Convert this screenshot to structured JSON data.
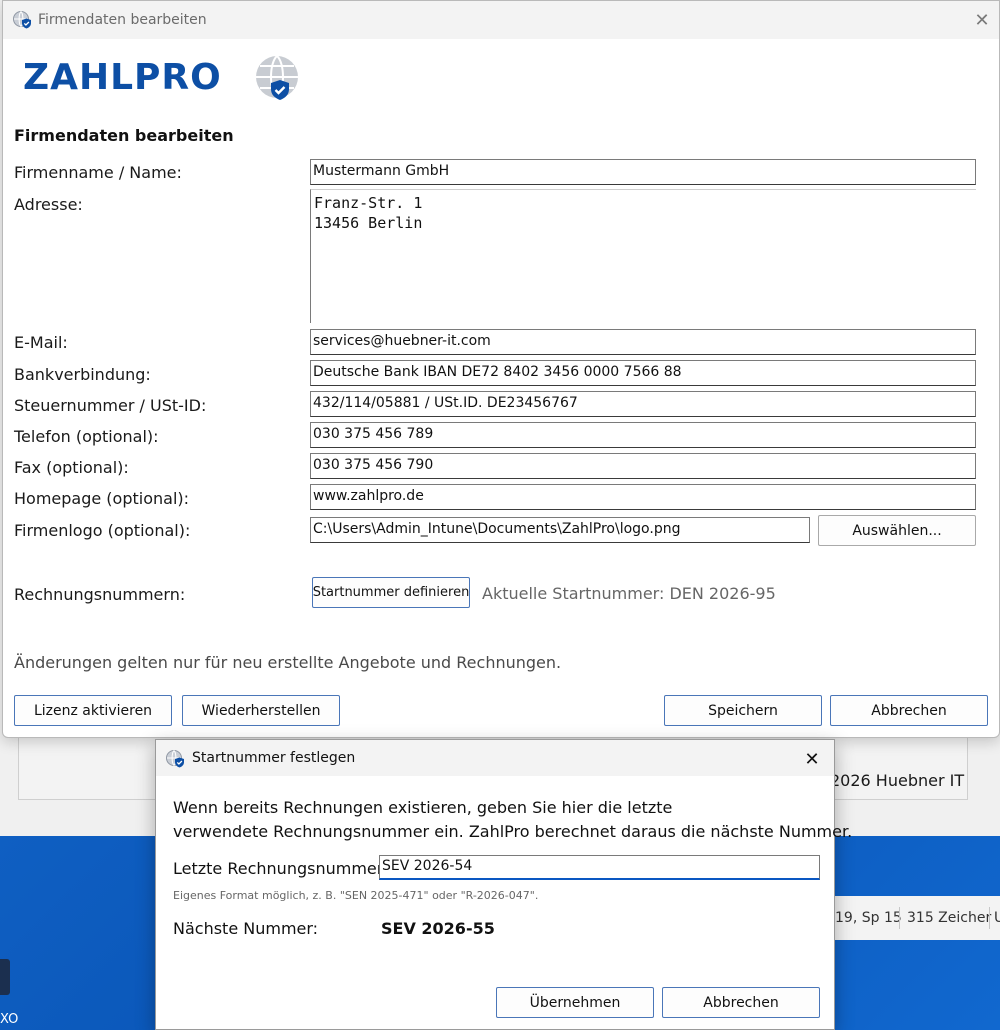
{
  "background": {
    "copyright": "2026 Huebner IT",
    "status_position": "19, Sp 15",
    "status_chars": "315 Zeicher",
    "status_u": "U",
    "desktop_icon_label": "XO"
  },
  "main_dialog": {
    "title": "Firmendaten bearbeiten",
    "logo_text": "ZAHLPRO",
    "heading": "Firmendaten bearbeiten",
    "fields": {
      "company_name": {
        "label": "Firmenname / Name:",
        "value": "Mustermann GmbH"
      },
      "address": {
        "label": "Adresse:",
        "value": "Franz-Str. 1\n13456 Berlin"
      },
      "email": {
        "label": "E-Mail:",
        "value": "services@huebner-it.com"
      },
      "bank": {
        "label": "Bankverbindung:",
        "value": "Deutsche Bank IBAN DE72 8402 3456 0000 7566 88"
      },
      "tax": {
        "label": "Steuernummer / USt-ID:",
        "value": "432/114/05881 / USt.ID. DE23456767"
      },
      "phone": {
        "label": "Telefon (optional):",
        "value": "030 375 456 789"
      },
      "fax": {
        "label": "Fax (optional):",
        "value": "030 375 456 790"
      },
      "homepage": {
        "label": "Homepage (optional):",
        "value": "www.zahlpro.de"
      },
      "logo": {
        "label": "Firmenlogo (optional):",
        "value": "C:\\Users\\Admin_Intune\\Documents\\ZahlPro\\logo.png"
      }
    },
    "choose_button": "Auswählen...",
    "invoice_numbers_label": "Rechnungsnummern:",
    "define_start_button": "Startnummer definieren",
    "current_start_info": "Aktuelle Startnummer: DEN 2026-95",
    "hint": "Änderungen gelten nur für neu erstellte Angebote und Rechnungen.",
    "buttons": {
      "license": "Lizenz aktivieren",
      "restore": "Wiederherstellen",
      "save": "Speichern",
      "cancel": "Abbrechen"
    }
  },
  "sub_dialog": {
    "title": "Startnummer festlegen",
    "description_line1": "Wenn bereits Rechnungen existieren, geben Sie hier die letzte",
    "description_line2": "verwendete Rechnungsnummer ein. ZahlPro berechnet daraus die nächste Nummer.",
    "last_number_label": "Letzte Rechnungsnummer:",
    "last_number_value": "SEV 2026-54",
    "format_hint": "Eigenes Format möglich, z. B. \"SEN 2025-471\" oder \"R-2026-047\".",
    "next_number_label": "Nächste Nummer:",
    "next_number_value": "SEV 2026-55",
    "buttons": {
      "apply": "Übernehmen",
      "cancel": "Abbrechen"
    }
  },
  "icons": {
    "app_icon": "globe-shield-icon",
    "close_icon": "close-icon"
  },
  "colors": {
    "brand_blue": "#0d4fa5",
    "accent_blue": "#0a57c2",
    "desktop_blue": "#0f5fc2"
  }
}
